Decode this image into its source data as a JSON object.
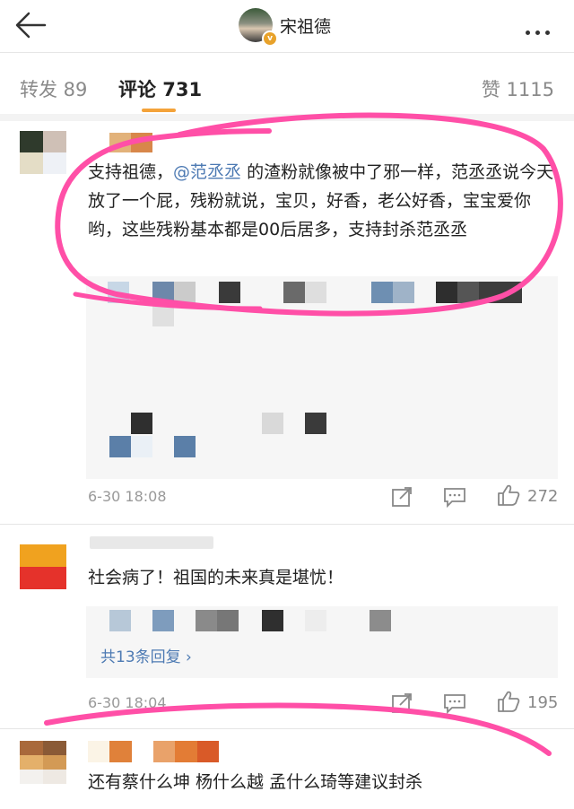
{
  "header": {
    "title": "宋祖德",
    "badge": "v",
    "icons": {
      "back": "back-arrow-icon",
      "more": "more-dots-icon"
    }
  },
  "tabs": {
    "repost": "转发 89",
    "comment": "评论 731",
    "like": "赞 1115",
    "accent_color": "#f4a33a"
  },
  "comments": [
    {
      "text_before": "支持祖德，",
      "mention": "@范丞丞",
      "text_after": " 的渣粉就像被中了邪一样，范丞丞说今天放了一个屁，残粉就说，宝贝，好香，老公好香，宝宝爱你哟，这些残粉基本都是00后居多，支持封杀范丞丞",
      "time": "6-30 18:08",
      "likes": "272"
    },
    {
      "text": "社会病了！祖国的未来真是堪忧！",
      "reply_link": "共13条回复 ›",
      "time": "6-30 18:04",
      "likes": "195"
    },
    {
      "text": "还有蔡什么坤 杨什么越 孟什么琦等建议封杀"
    }
  ],
  "colors": {
    "link": "#4d7ab3",
    "highlight_circle": "#ff4fa7"
  }
}
